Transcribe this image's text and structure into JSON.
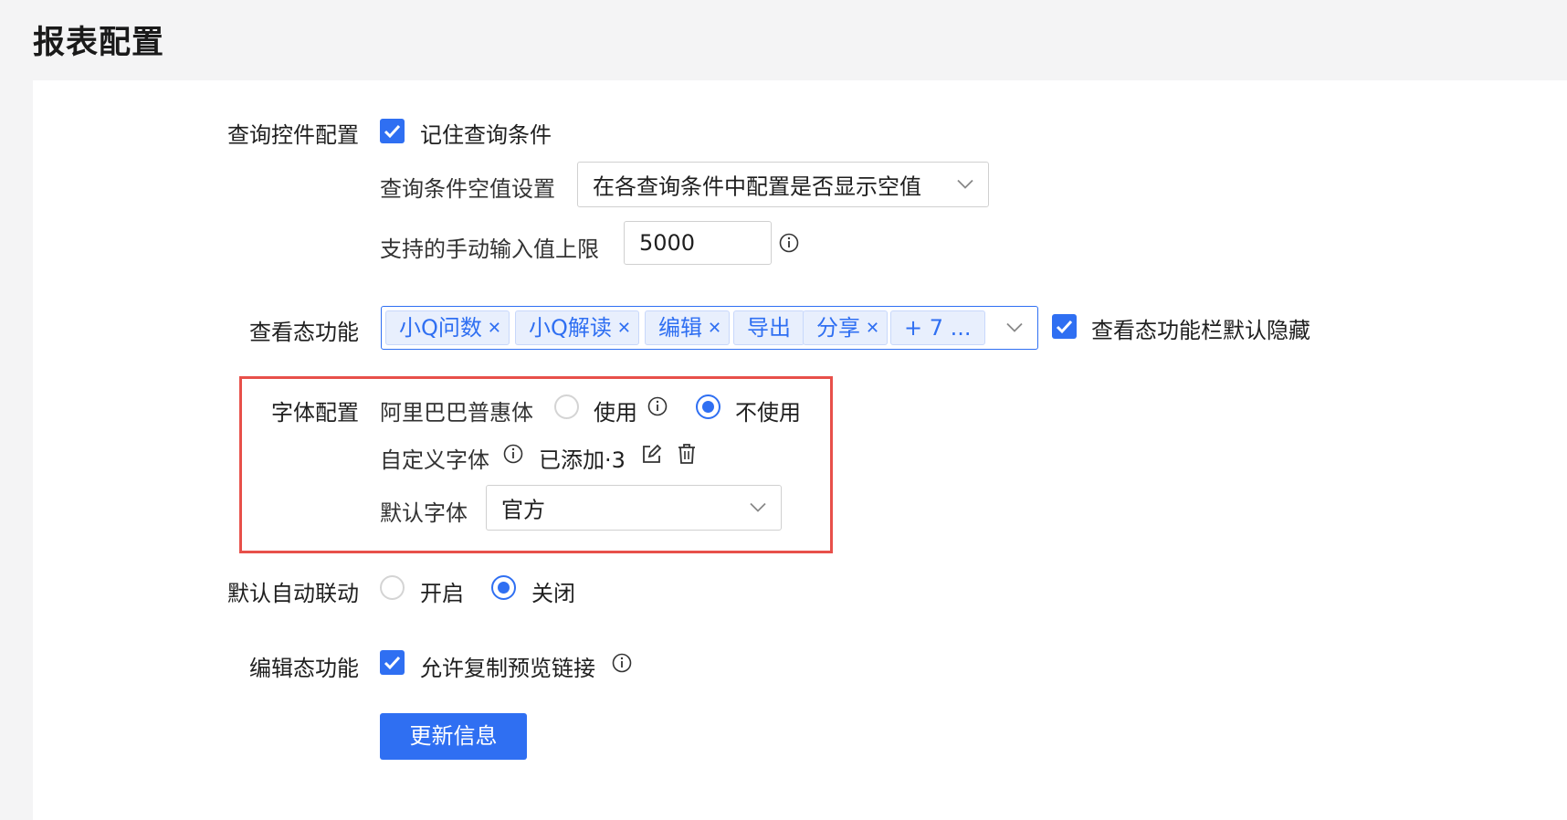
{
  "page": {
    "title": "报表配置"
  },
  "query_control": {
    "label": "查询控件配置",
    "remember_label": "记住查询条件",
    "empty_value_label": "查询条件空值设置",
    "empty_value_select": "在各查询条件中配置是否显示空值",
    "manual_limit_label": "支持的手动输入值上限",
    "manual_limit_value": "5000"
  },
  "view_features": {
    "label": "查看态功能",
    "tags": [
      "小Q问数",
      "小Q解读",
      "编辑",
      "导出",
      "分享",
      "+ 7 ..."
    ],
    "hide_default_label": "查看态功能栏默认隐藏"
  },
  "font_config": {
    "label": "字体配置",
    "alibaba_label": "阿里巴巴普惠体",
    "use_label": "使用",
    "not_use_label": "不使用",
    "alibaba_selected": "不使用",
    "custom_font_label": "自定义字体",
    "added_text": "已添加·3",
    "default_font_label": "默认字体",
    "default_font_value": "官方"
  },
  "auto_link": {
    "label": "默认自动联动",
    "on_label": "开启",
    "off_label": "关闭",
    "selected": "关闭"
  },
  "edit_features": {
    "label": "编辑态功能",
    "copy_link_label": "允许复制预览链接"
  },
  "actions": {
    "update_label": "更新信息"
  },
  "colors": {
    "primary": "#2f6ff2",
    "highlight": "#e8504a"
  }
}
